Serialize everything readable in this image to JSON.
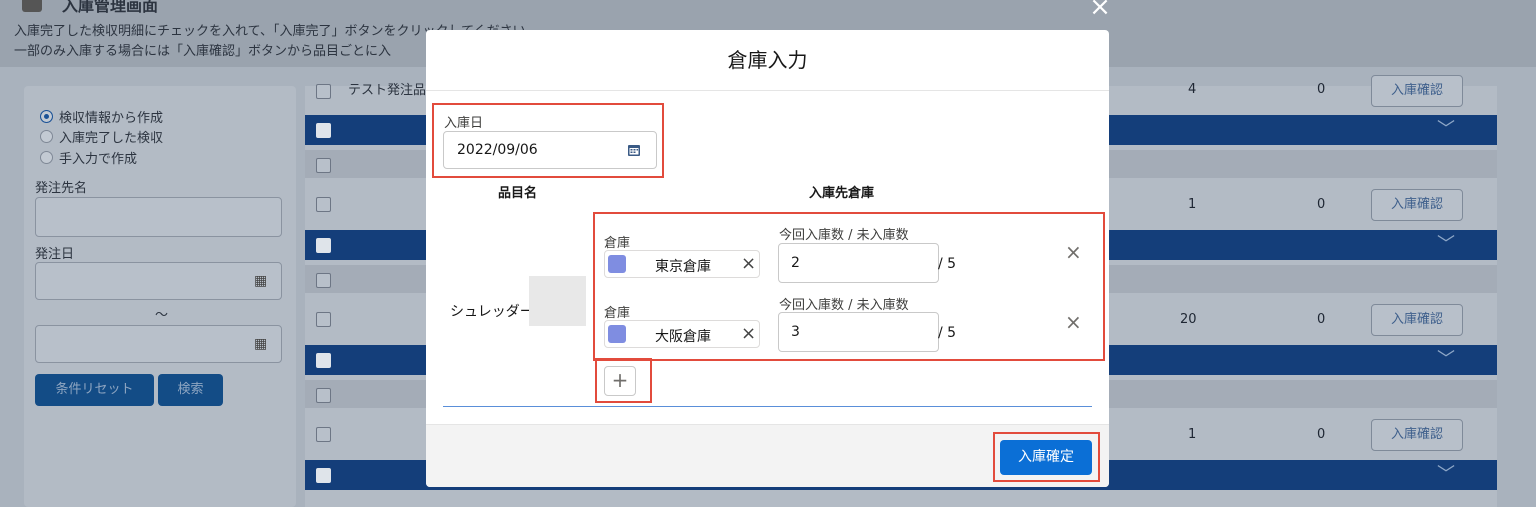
{
  "background": {
    "title": "入庫管理画面",
    "desc_line1": "入庫完了した検収明細にチェックを入れて、「入庫完了」ボタンをクリックしてください。",
    "desc_line2": "一部のみ入庫する場合には「入庫確認」ボタンから品目ごとに入",
    "filter": {
      "radio_options": [
        "検収情報から作成",
        "入庫完了した検収",
        "手入力で作成"
      ],
      "supplier_label": "発注先名",
      "order_date_label": "発注日",
      "range_sep": "〜",
      "reset_button": "条件リセット",
      "search_button": "検索"
    },
    "list": {
      "first_row_text": "テスト発注品",
      "rows": [
        {
          "qty": "4",
          "received": "0",
          "button": "入庫確認"
        },
        {
          "qty": "1",
          "received": "0",
          "button": "入庫確認"
        },
        {
          "qty": "20",
          "received": "0",
          "button": "入庫確認"
        },
        {
          "qty": "1",
          "received": "0",
          "button": "入庫確認"
        }
      ]
    }
  },
  "modal": {
    "title": "倉庫入力",
    "receipt_date_label": "入庫日",
    "receipt_date_value": "2022/09/06",
    "col_item": "品目名",
    "col_warehouse": "入庫先倉庫",
    "item_name": "シュレッダー",
    "entries": [
      {
        "warehouse_label": "倉庫",
        "warehouse": "東京倉庫",
        "qty_label": "今回入庫数 / 未入庫数",
        "qty": "2",
        "remaining": "/ 5"
      },
      {
        "warehouse_label": "倉庫",
        "warehouse": "大阪倉庫",
        "qty_label": "今回入庫数 / 未入庫数",
        "qty": "3",
        "remaining": "/ 5"
      }
    ],
    "add_symbol": "+",
    "confirm_button": "入庫確定",
    "close_symbol": "×"
  },
  "colors": {
    "accent": "#0b6fd6",
    "highlight": "#e24b3c",
    "overlay_dark": "#143e7a"
  },
  "icons": [
    "calendar-icon",
    "building-icon",
    "close-icon",
    "plus-icon",
    "chevron-down-icon"
  ]
}
